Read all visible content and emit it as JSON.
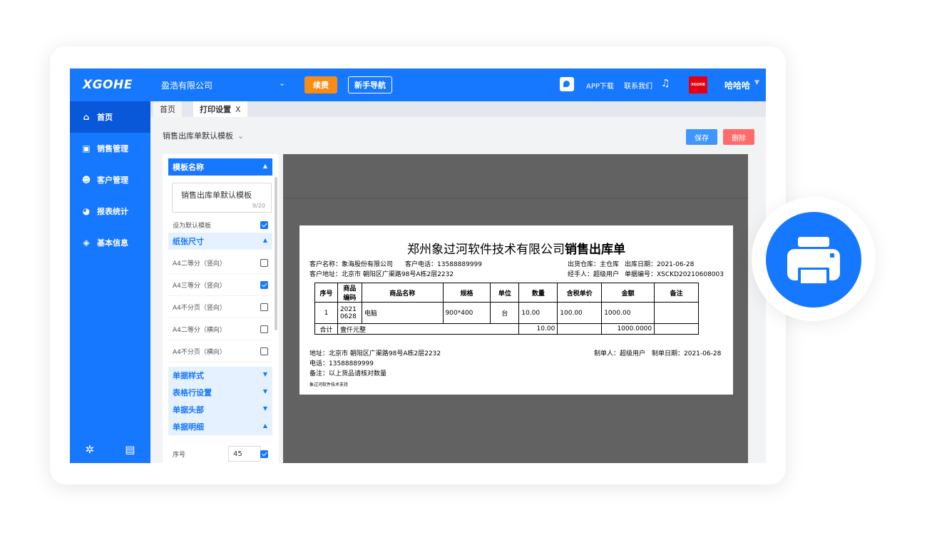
{
  "header": {
    "logo": "XGOHE",
    "company": "盈浩有限公司",
    "renew_label": "续费",
    "guide_label": "新手导航",
    "app_download": "APP下载",
    "contact": "联系我们",
    "avatar_text": "XGOHE",
    "username": "哈哈哈"
  },
  "sidebar": {
    "items": [
      {
        "label": "首页",
        "icon": "home-icon"
      },
      {
        "label": "销售管理",
        "icon": "chart-icon"
      },
      {
        "label": "客户管理",
        "icon": "user-icon"
      },
      {
        "label": "报表统计",
        "icon": "pie-icon"
      },
      {
        "label": "基本信息",
        "icon": "layers-icon"
      }
    ]
  },
  "tabs": [
    {
      "label": "首页"
    },
    {
      "label": "打印设置",
      "close": "X"
    }
  ],
  "toolbar": {
    "template_name": "销售出库单默认模板",
    "save_label": "保存",
    "delete_label": "删除"
  },
  "settings": {
    "template_section": "模板名称",
    "template_value": "销售出库单默认模板",
    "char_count": "9/20",
    "default_label": "设为默认模板",
    "default_checked": true,
    "paper_section": "纸张尺寸",
    "paper_options": [
      {
        "label": "A4二等分（竖向）",
        "checked": false
      },
      {
        "label": "A4三等分（竖向）",
        "checked": true
      },
      {
        "label": "A4不分页（竖向）",
        "checked": false
      },
      {
        "label": "A4二等分（横向）",
        "checked": false
      },
      {
        "label": "A4不分页（横向）",
        "checked": false
      }
    ],
    "collapsed_sections": [
      "单据样式",
      "表格行设置",
      "单据头部"
    ],
    "detail_section": "单据明细",
    "seq_label": "序号",
    "seq_value": "45",
    "seq_checked": true
  },
  "document": {
    "title_company": "郑州象过河软件技术有限公司",
    "title_doc": "销售出库单",
    "customer_name": "客户名称：象海股份有限公司",
    "customer_phone": "客户电话：13588889999",
    "warehouse": "出货仓库：主仓库",
    "out_date": "出库日期：2021-06-28",
    "customer_address": "客户地址：北京市 朝阳区广渠路98号A栋2层2232",
    "handler": "经手人：超级用户",
    "doc_no": "单据编号：XSCKD20210608003",
    "table_headers": [
      "序号",
      "商品编码",
      "商品名称",
      "规格",
      "单位",
      "数量",
      "含税单价",
      "金额",
      "备注"
    ],
    "table_row": [
      "1",
      "2021 0628",
      "电脑",
      "900*400",
      "台",
      "10.00",
      "100.00",
      "1000.00",
      ""
    ],
    "total_label": "合计",
    "total_words": "壹仟元整",
    "total_qty": "10.00",
    "total_amount": "1000.0000",
    "footer_address": "地址：北京市 朝阳区广渠路98号A栋2层2232",
    "footer_phone": "电话：13588889999",
    "footer_note": "备注：以上货品请核对数量",
    "maker": "制单人：超级用户",
    "make_date": "制单日期：2021-06-28",
    "support": "象过河软件技术支持"
  },
  "print_badge": {
    "icon": "printer-icon"
  }
}
